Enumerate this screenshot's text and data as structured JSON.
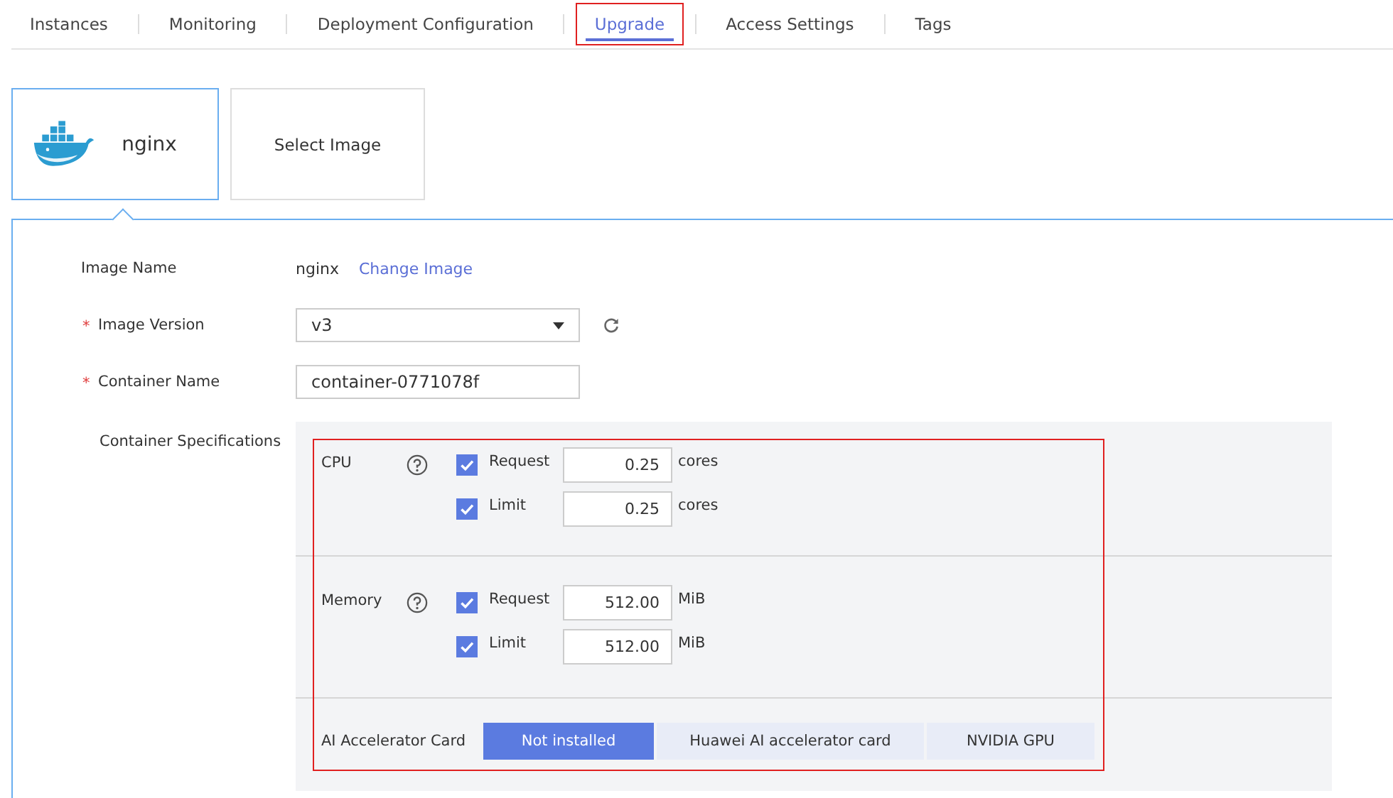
{
  "tabs": [
    {
      "label": "Instances",
      "selected": false,
      "highlighted": false
    },
    {
      "label": "Monitoring",
      "selected": false,
      "highlighted": false
    },
    {
      "label": "Deployment Configuration",
      "selected": false,
      "highlighted": false
    },
    {
      "label": "Upgrade",
      "selected": true,
      "highlighted": true
    },
    {
      "label": "Access Settings",
      "selected": false,
      "highlighted": false
    },
    {
      "label": "Tags",
      "selected": false,
      "highlighted": false
    }
  ],
  "image_cards": [
    {
      "kind": "image",
      "label": "nginx",
      "selected": true
    },
    {
      "kind": "add",
      "label": "Select Image",
      "selected": false
    }
  ],
  "form": {
    "image_name": {
      "label": "Image Name",
      "value": "nginx",
      "link": "Change Image"
    },
    "image_version": {
      "label": "Image Version",
      "required_mark": "*",
      "value": "v3"
    },
    "container_name": {
      "label": "Container Name",
      "required_mark": "*",
      "value": "container-0771078f"
    },
    "specs": {
      "label": "Container Specifications",
      "highlighted": true,
      "resources": [
        {
          "label": "CPU",
          "rows": [
            {
              "label": "Request",
              "checked": true,
              "value": "0.25",
              "unit": "cores"
            },
            {
              "label": "Limit",
              "checked": true,
              "value": "0.25",
              "unit": "cores"
            }
          ]
        },
        {
          "label": "Memory",
          "rows": [
            {
              "label": "Request",
              "checked": true,
              "value": "512.00",
              "unit": "MiB"
            },
            {
              "label": "Limit",
              "checked": true,
              "value": "512.00",
              "unit": "MiB"
            }
          ]
        }
      ],
      "accelerator": {
        "label": "AI Accelerator Card",
        "options": [
          {
            "label": "Not installed",
            "selected": true
          },
          {
            "label": "Huawei AI accelerator card",
            "selected": false
          },
          {
            "label": "NVIDIA GPU",
            "selected": false
          }
        ]
      }
    }
  }
}
